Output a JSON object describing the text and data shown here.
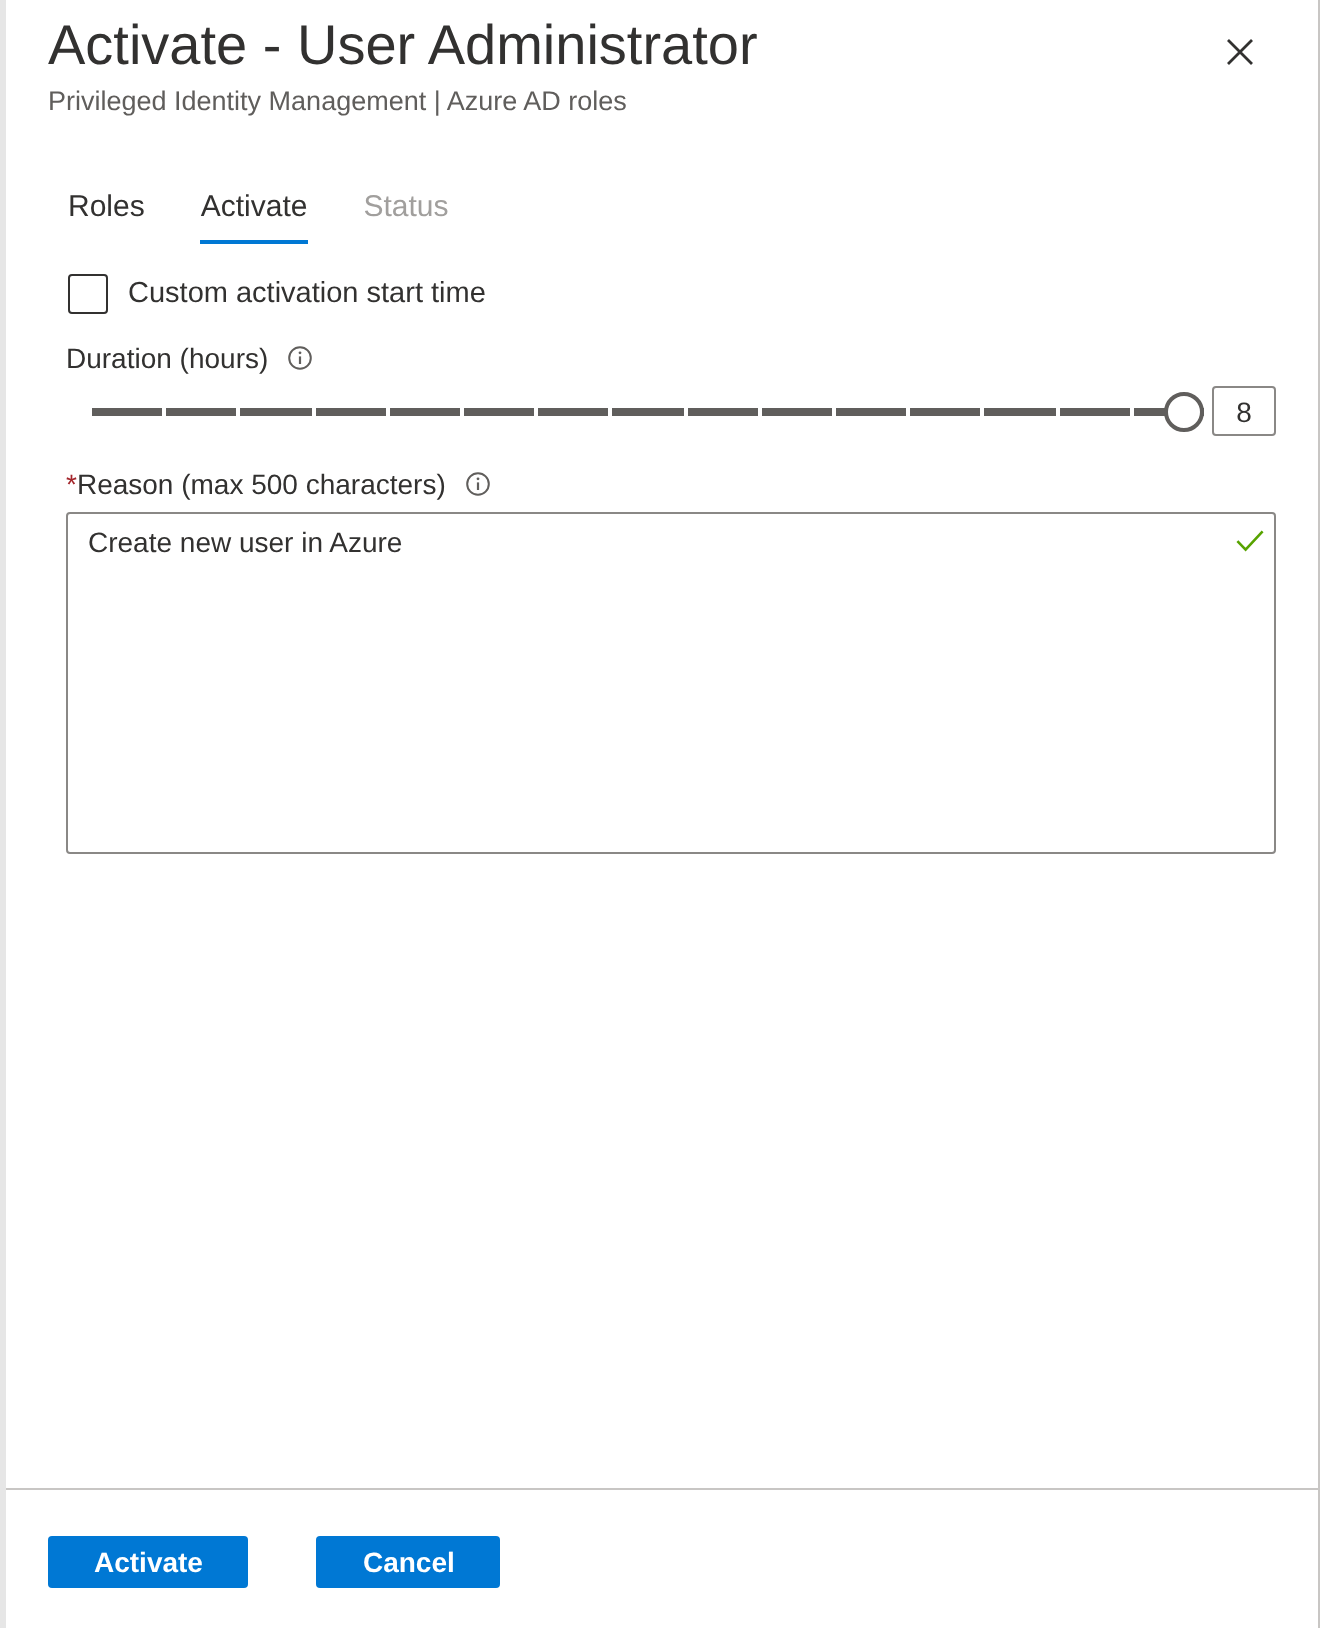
{
  "panel": {
    "title": "Activate - User Administrator",
    "subtitle": "Privileged Identity Management | Azure AD roles"
  },
  "tabs": [
    {
      "label": "Roles",
      "selected": false,
      "disabled": false
    },
    {
      "label": "Activate",
      "selected": true,
      "disabled": false
    },
    {
      "label": "Status",
      "selected": false,
      "disabled": true
    }
  ],
  "form": {
    "custom_start": {
      "label": "Custom activation start time",
      "checked": false
    },
    "duration": {
      "label": "Duration (hours)",
      "level": 1,
      "value": "8"
    },
    "reason": {
      "required_mark": "*",
      "label": "Reason (max 500 characters)",
      "value": "Create new user in Azure",
      "valid": true
    }
  },
  "buttons": [
    "Activate",
    "Cancel"
  ]
}
